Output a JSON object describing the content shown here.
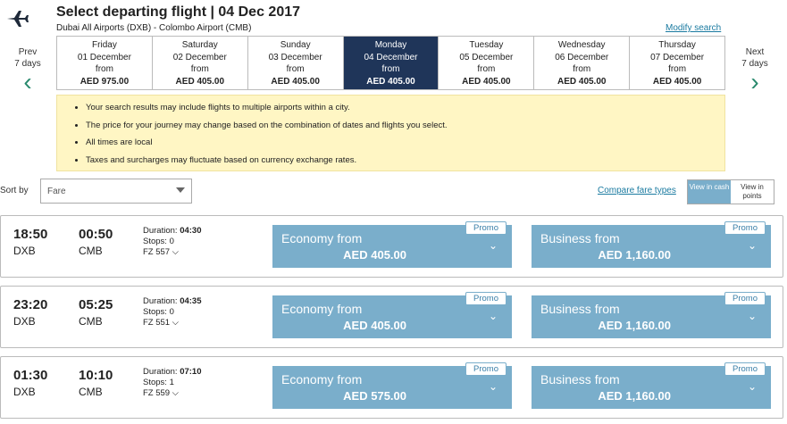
{
  "header": {
    "title": "Select departing flight | 04 Dec 2017",
    "route": "Dubai All Airports (DXB) - Colombo Airport (CMB)",
    "modify": "Modify search"
  },
  "nav": {
    "prev_label": "Prev",
    "prev_sub": "7 days",
    "next_label": "Next",
    "next_sub": "7 days"
  },
  "dates": [
    {
      "day": "Friday",
      "date": "01 December",
      "from": "from",
      "price": "AED 975.00"
    },
    {
      "day": "Saturday",
      "date": "02 December",
      "from": "from",
      "price": "AED 405.00"
    },
    {
      "day": "Sunday",
      "date": "03 December",
      "from": "from",
      "price": "AED 405.00"
    },
    {
      "day": "Monday",
      "date": "04 December",
      "from": "from",
      "price": "AED 405.00"
    },
    {
      "day": "Tuesday",
      "date": "05 December",
      "from": "from",
      "price": "AED 405.00"
    },
    {
      "day": "Wednesday",
      "date": "06 December",
      "from": "from",
      "price": "AED 405.00"
    },
    {
      "day": "Thursday",
      "date": "07 December",
      "from": "from",
      "price": "AED 405.00"
    }
  ],
  "notice": [
    "Your search results may include flights to multiple airports within a city.",
    "The price for your journey may change based on the combination of dates and flights you select.",
    "All times are local",
    "Taxes and surcharges may fluctuate based on currency exchange rates."
  ],
  "sort": {
    "label": "Sort by",
    "value": "Fare"
  },
  "compare": "Compare fare types",
  "toggle": {
    "cash": "View in cash",
    "points": "View in points"
  },
  "flights": [
    {
      "dep": "18:50",
      "arr": "00:50",
      "from": "DXB",
      "to": "CMB",
      "duration_label": "Duration:",
      "duration": "04:30",
      "stops": "Stops: 0",
      "flight_no": "FZ 557",
      "economy": {
        "label": "Economy from",
        "price": "AED 405.00",
        "promo": "Promo"
      },
      "business": {
        "label": "Business from",
        "price": "AED 1,160.00",
        "promo": "Promo"
      }
    },
    {
      "dep": "23:20",
      "arr": "05:25",
      "from": "DXB",
      "to": "CMB",
      "duration_label": "Duration:",
      "duration": "04:35",
      "stops": "Stops: 0",
      "flight_no": "FZ 551",
      "economy": {
        "label": "Economy from",
        "price": "AED 405.00",
        "promo": "Promo"
      },
      "business": {
        "label": "Business from",
        "price": "AED 1,160.00",
        "promo": "Promo"
      }
    },
    {
      "dep": "01:30",
      "arr": "10:10",
      "from": "DXB",
      "to": "CMB",
      "duration_label": "Duration:",
      "duration": "07:10",
      "stops": "Stops: 1",
      "flight_no": "FZ 559",
      "economy": {
        "label": "Economy from",
        "price": "AED 575.00",
        "promo": "Promo"
      },
      "business": {
        "label": "Business from",
        "price": "AED 1,160.00",
        "promo": "Promo"
      }
    }
  ]
}
